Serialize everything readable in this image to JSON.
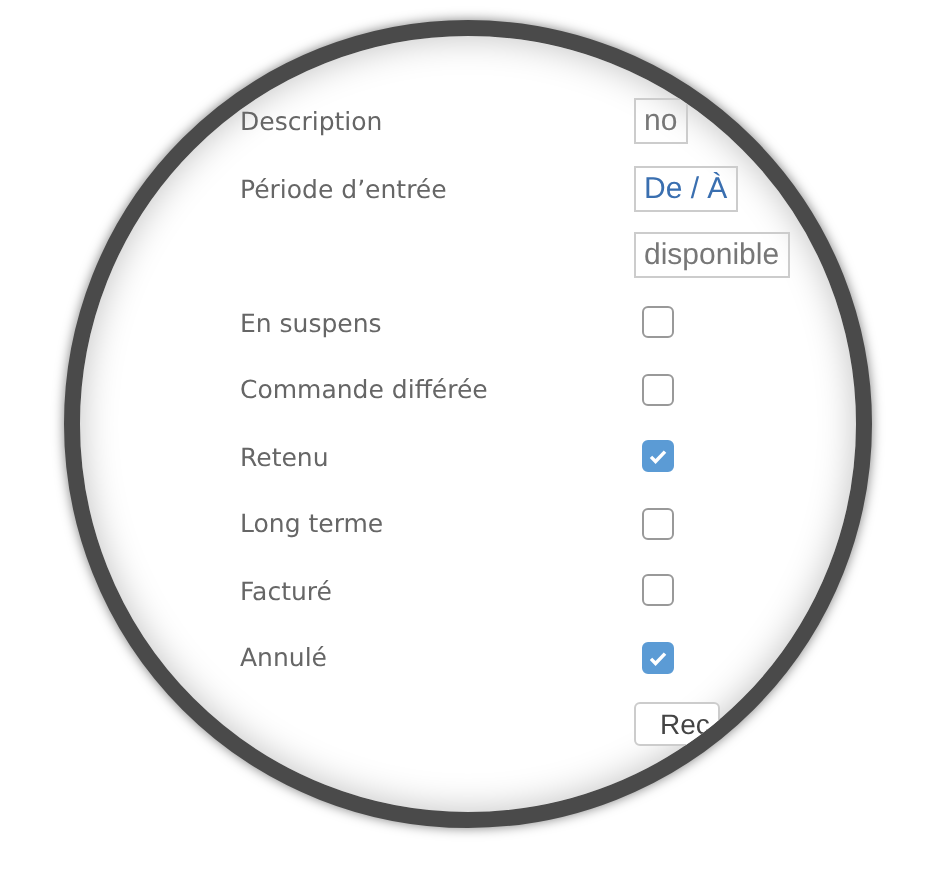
{
  "rows": [
    {
      "label": "Description",
      "kind": "field",
      "value": "no"
    },
    {
      "label": "Période d’entrée",
      "kind": "range",
      "value": "De / À"
    },
    {
      "kind": "field",
      "value": "disponible"
    },
    {
      "label": "En suspens",
      "kind": "checkbox",
      "checked": false
    },
    {
      "label": "Commande différée",
      "kind": "checkbox",
      "checked": false
    },
    {
      "label": "Retenu",
      "kind": "checkbox",
      "checked": true
    },
    {
      "label": "Long terme",
      "kind": "checkbox",
      "checked": false
    },
    {
      "label": "Facturé",
      "kind": "checkbox",
      "checked": false
    },
    {
      "label": "Annulé",
      "kind": "checkbox",
      "checked": true
    },
    {
      "kind": "button",
      "label": "Rec"
    }
  ]
}
